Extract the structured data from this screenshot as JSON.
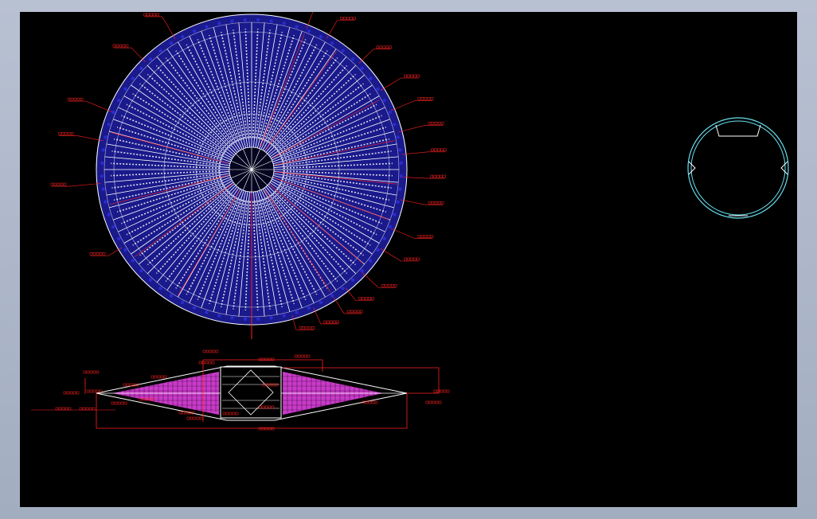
{
  "colors": {
    "background": "#000000",
    "frame": "#a9b4c6",
    "disc_fill": "#1a1a8c",
    "panel_fill": "#0c0c3a",
    "line_white": "#ffffff",
    "dimension_red": "#ff2020",
    "section_magenta": "#e040e0",
    "detail_cyan": "#66e0f0"
  },
  "plan_view": {
    "ribs": 72,
    "label_lines": 22
  },
  "section_view": {
    "label_count": 22
  },
  "detail_view": {
    "notches": 3
  }
}
